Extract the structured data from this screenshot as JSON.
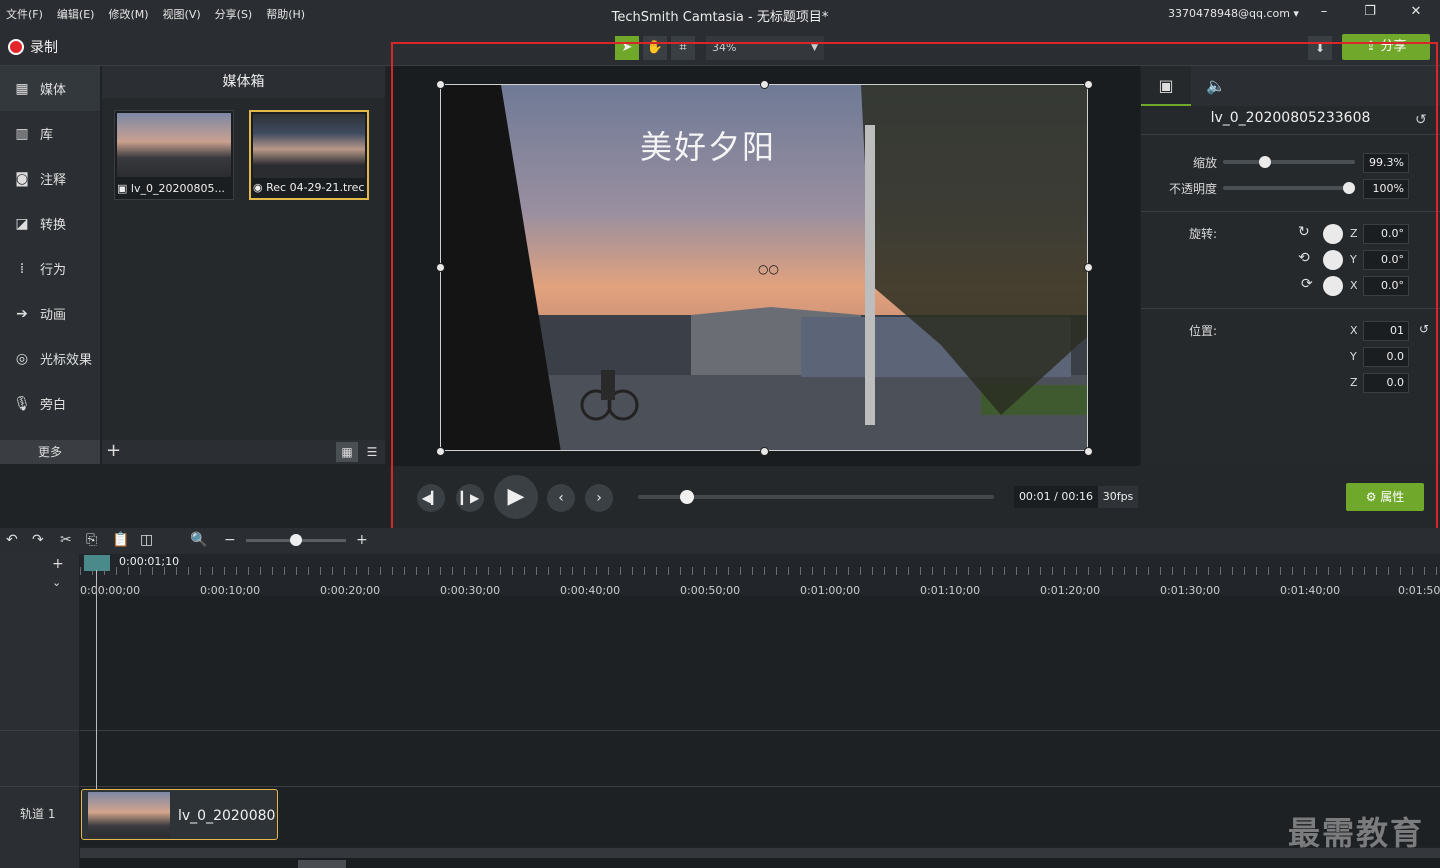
{
  "menu": [
    "文件(F)",
    "编辑(E)",
    "修改(M)",
    "视图(V)",
    "分享(S)",
    "帮助(H)"
  ],
  "app_title": "TechSmith Camtasia - 无标题项目*",
  "account": "3370478948@qq.com ▾",
  "window_controls": {
    "minimize": "–",
    "restore": "❐",
    "close": "✕"
  },
  "toolbar": {
    "record_label": "录制",
    "zoom_value": "34%",
    "share_label": "分享"
  },
  "leftnav": {
    "items": [
      {
        "label": "媒体",
        "icon": "media-icon"
      },
      {
        "label": "库",
        "icon": "library-icon"
      },
      {
        "label": "注释",
        "icon": "annotation-icon"
      },
      {
        "label": "转换",
        "icon": "transition-icon"
      },
      {
        "label": "行为",
        "icon": "behavior-icon"
      },
      {
        "label": "动画",
        "icon": "animation-icon"
      },
      {
        "label": "光标效果",
        "icon": "cursor-effect-icon"
      },
      {
        "label": "旁白",
        "icon": "microphone-icon"
      }
    ],
    "more_label": "更多"
  },
  "mediabin": {
    "title": "媒体箱",
    "items": [
      {
        "caption": "lv_0_20200805...",
        "selected": false
      },
      {
        "caption": "Rec 04-29-21.trec",
        "selected": true
      }
    ]
  },
  "canvas": {
    "overlay_text": "美好夕阳"
  },
  "properties": {
    "clip_name": "lv_0_20200805233608",
    "scale_label": "缩放",
    "scale_value": "99.3%",
    "scale_level": 0.3,
    "opacity_label": "不透明度",
    "opacity_value": "100%",
    "opacity_level": 1.0,
    "rotation_label": "旋转:",
    "rotation": {
      "z": "0.0°",
      "y": "0.0°",
      "x": "0.0°"
    },
    "position_label": "位置:",
    "position": {
      "x": "01",
      "y": "0.0",
      "z": "0.0"
    },
    "axis_labels": {
      "x": "X",
      "y": "Y",
      "z": "Z"
    },
    "properties_button": "属性"
  },
  "playback": {
    "time": "00:01 / 00:16",
    "fps": "30fps",
    "progress": 0.0625
  },
  "timeline": {
    "playhead_time": "0:00:01;10",
    "ruler_labels": [
      "0:00:00;00",
      "0:00:10;00",
      "0:00:20;00",
      "0:00:30;00",
      "0:00:40;00",
      "0:00:50;00",
      "0:01:00;00",
      "0:01:10;00",
      "0:01:20;00",
      "0:01:30;00",
      "0:01:40;00",
      "0:01:50;"
    ],
    "track_label": "轨道 1",
    "clip_label": "lv_0_2020080"
  },
  "watermark": "最需教育",
  "colors": {
    "accent": "#6fa82b",
    "highlight_box": "#d9262b",
    "selected_border": "#e5b84a",
    "record": "#e2262c"
  }
}
